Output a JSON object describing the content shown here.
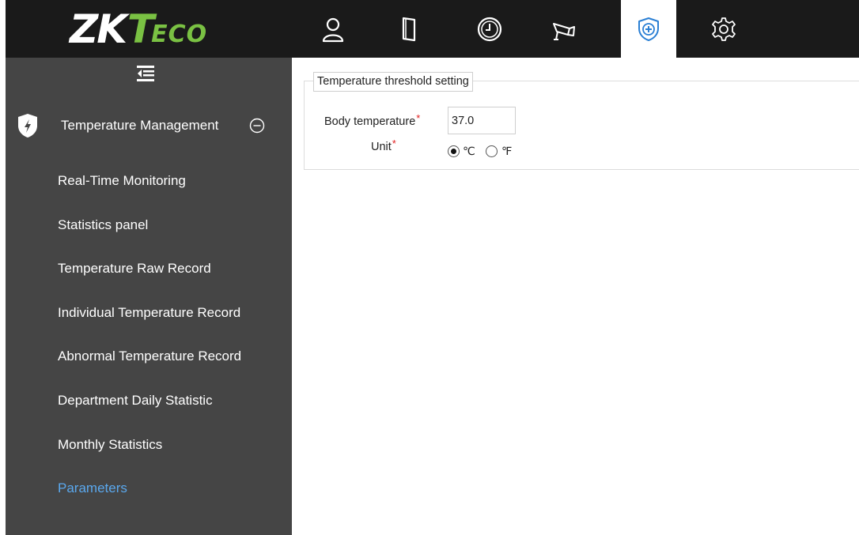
{
  "brand": {
    "main": "ZK",
    "accent": "T",
    "suffix": "ECO"
  },
  "topnav": {
    "icons": [
      "person-icon",
      "door-icon",
      "clock-icon",
      "camera-icon",
      "shield-plus-icon",
      "gear-icon"
    ],
    "active": "shield-plus-icon"
  },
  "sidebar": {
    "section_title": "Temperature Management",
    "items": [
      {
        "label": "Real-Time Monitoring",
        "active": false
      },
      {
        "label": "Statistics panel",
        "active": false
      },
      {
        "label": "Temperature Raw Record",
        "active": false
      },
      {
        "label": "Individual Temperature Record",
        "active": false
      },
      {
        "label": "Abnormal Temperature Record",
        "active": false
      },
      {
        "label": "Department Daily Statistic",
        "active": false
      },
      {
        "label": "Monthly Statistics",
        "active": false
      },
      {
        "label": "Parameters",
        "active": true
      }
    ]
  },
  "form": {
    "legend": "Temperature threshold setting",
    "body_temp_label": "Body temperature",
    "required_mark": "*",
    "body_temp_value": "37.0",
    "unit_label": "Unit",
    "unit_options": [
      "℃",
      "℉"
    ],
    "unit_selected": "℃"
  },
  "colors": {
    "topbar": "#1a1a1a",
    "sidebar": "#454545",
    "active_item": "#5aa8ee",
    "brand_green": "#7ac143",
    "required": "#e01e1e"
  }
}
